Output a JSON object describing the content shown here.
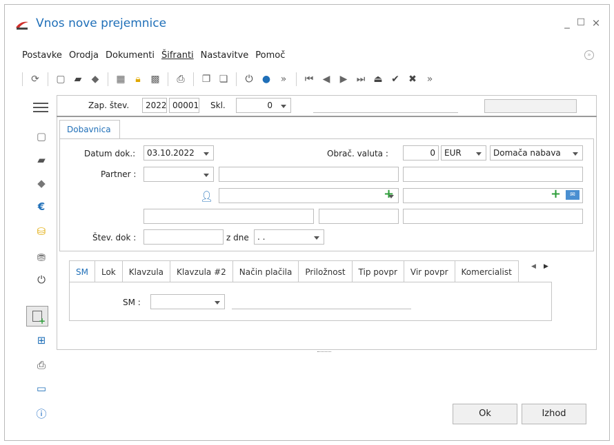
{
  "window": {
    "title": "Vnos nove prejemnice",
    "min_glyph": "_",
    "max_glyph": "□",
    "close_glyph": "×"
  },
  "menu": {
    "items": [
      "Postavke",
      "Orodja",
      "Dokumenti",
      "Šifranti",
      "Nastavitve",
      "Pomoč"
    ]
  },
  "header": {
    "zap_label": "Zap. štev.",
    "year_value": "2022",
    "number_value": "00001",
    "skl_label": "Skl.",
    "skl_value": "0"
  },
  "tabs": {
    "main": "Dobavnica"
  },
  "form": {
    "datum_label": "Datum dok.:",
    "datum_value": "03.10.2022",
    "valuta_label": "Obrač. valuta :",
    "valuta_amount": "0",
    "valuta_currency": "EUR",
    "nabava_value": "Domača nabava",
    "partner_label": "Partner :",
    "stev_dok_label": "Štev. dok :",
    "z_dne_label": "z dne",
    "z_dne_value": " .  ."
  },
  "subtabs": [
    "SM",
    "Lok",
    "Klavzula",
    "Klavzula #2",
    "Način plačila",
    "Priložnost",
    "Tip povpr",
    "Vir povpr",
    "Komercialist"
  ],
  "sm": {
    "label": "SM :"
  },
  "buttons": {
    "ok": "Ok",
    "exit": "Izhod"
  },
  "colors": {
    "accent": "#1f6fb8",
    "green": "#2e9e3a",
    "info": "#1565c0"
  }
}
